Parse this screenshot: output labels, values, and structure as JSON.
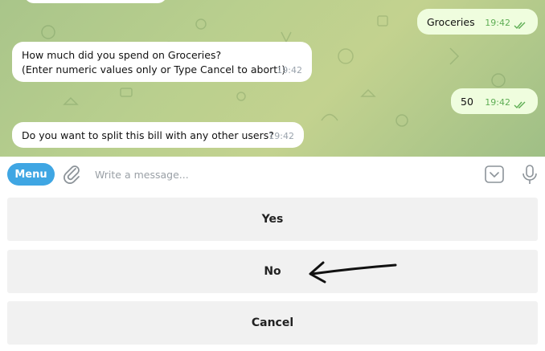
{
  "messages": [
    {
      "side": "out",
      "text": "Groceries",
      "time": "19:42"
    },
    {
      "side": "in",
      "lines": [
        "How much did you spend on Groceries?",
        "(Enter numeric values only or Type Cancel to abort!)"
      ],
      "time": "19:42"
    },
    {
      "side": "out",
      "text": "50",
      "time": "19:42"
    },
    {
      "side": "in",
      "text": "Do you want to split this bill with any other users?",
      "time": "19:42"
    }
  ],
  "composer": {
    "menu_label": "Menu",
    "placeholder": "Write a message..."
  },
  "keyboard": {
    "buttons": [
      "Yes",
      "No",
      "Cancel"
    ]
  },
  "icons": {
    "attach": "paperclip-icon",
    "keyboard": "keyboard-toggle-icon",
    "mic": "microphone-icon",
    "read": "double-check-icon"
  },
  "colors": {
    "chat_bg": "#b5cc8c",
    "outgoing_bubble": "#effdde",
    "incoming_bubble": "#ffffff",
    "menu_button": "#3fa6e3",
    "keyboard_button": "#f1f1f1"
  }
}
